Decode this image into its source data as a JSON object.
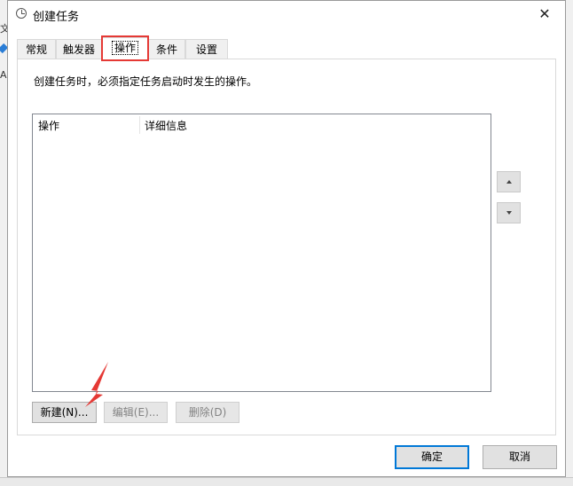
{
  "window": {
    "title": "创建任务",
    "close_glyph": "✕"
  },
  "tabs": [
    {
      "label": "常规",
      "active": false
    },
    {
      "label": "触发器",
      "active": false
    },
    {
      "label": "操作",
      "active": true
    },
    {
      "label": "条件",
      "active": false
    },
    {
      "label": "设置",
      "active": false
    }
  ],
  "actions_tab": {
    "description": "创建任务时，必须指定任务启动时发生的操作。",
    "table": {
      "columns": [
        "操作",
        "详细信息"
      ],
      "rows": []
    },
    "buttons": {
      "new": "新建(N)...",
      "edit": "编辑(E)...",
      "delete": "删除(D)"
    }
  },
  "footer": {
    "ok": "确定",
    "cancel": "取消"
  },
  "background_fragments": [
    "文",
    "A"
  ],
  "colors": {
    "highlight": "#e53935",
    "default_button_border": "#0078d7"
  },
  "icons": {
    "title": "clock-icon",
    "move_up": "triangle-up-icon",
    "move_down": "triangle-down-icon"
  }
}
